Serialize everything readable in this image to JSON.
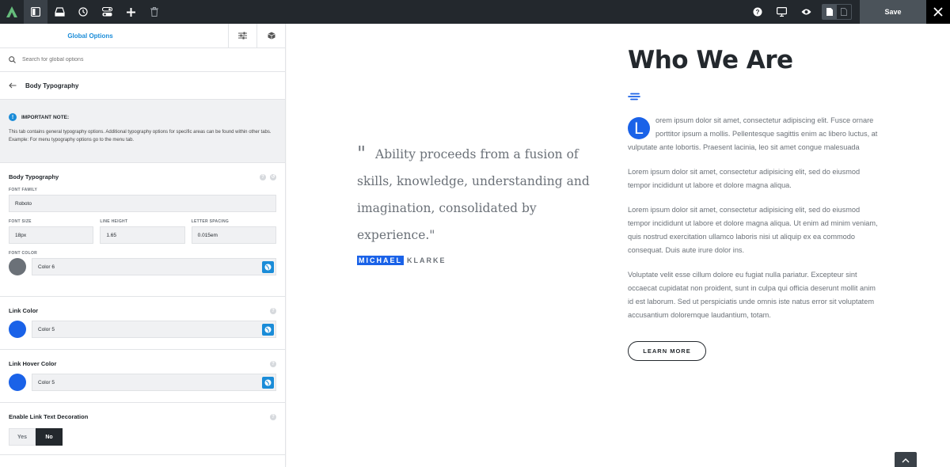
{
  "toolbar": {
    "save_label": "Save",
    "icons": [
      "avada-logo",
      "sidebar-toggle-icon",
      "library-icon",
      "history-icon",
      "toggle-options-icon",
      "add-icon",
      "trash-icon",
      "help-icon",
      "desktop-icon",
      "preview-eye-icon",
      "page-view-icon",
      "page-outline-icon",
      "close-icon"
    ]
  },
  "sidebar": {
    "tab_title": "Global Options",
    "search_placeholder": "Search for global options",
    "back_title": "Body Typography",
    "note": {
      "title": "IMPORTANT NOTE:",
      "text": "This tab contains general typography options. Additional typography options for specific areas can be found within other tabs. Example: For menu typography options go to the menu tab."
    },
    "body_typography": {
      "title": "Body Typography",
      "font_family_label": "FONT FAMILY",
      "font_family_value": "Roboto",
      "font_size_label": "FONT SIZE",
      "font_size_value": "18px",
      "line_height_label": "LINE HEIGHT",
      "line_height_value": "1.65",
      "letter_spacing_label": "LETTER SPACING",
      "letter_spacing_value": "0.015em",
      "font_color_label": "FONT COLOR",
      "font_color_value": "Color 6",
      "font_color_hex": "#6b7178"
    },
    "link_color": {
      "title": "Link Color",
      "value": "Color 5",
      "hex": "#1a62e8"
    },
    "link_hover_color": {
      "title": "Link Hover Color",
      "value": "Color 5",
      "hex": "#1a62e8"
    },
    "link_decoration": {
      "title": "Enable Link Text Decoration",
      "yes": "Yes",
      "no": "No",
      "selected": "No"
    }
  },
  "preview": {
    "quote_mark": "\"",
    "quote": "Ability proceeds from a fusion of skills, knowledge, understanding and imagination, consolidated by experience.\"",
    "author_first": "MICHAEL",
    "author_last": "KLARKE",
    "heading": "Who We Are",
    "dropcap": "L",
    "para1": "orem ipsum dolor sit amet, consectetur adipiscing elit. Fusce ornare porttitor ipsum a mollis. Pellentesque sagittis enim ac libero luctus, at vulputate ante lobortis. Praesent lacinia, leo sit amet congue malesuada",
    "para2": "Lorem ipsum dolor sit amet, consectetur adipisicing elit, sed do eiusmod tempor incididunt ut labore et dolore magna aliqua.",
    "para3": "Lorem ipsum dolor sit amet, consectetur adipisicing elit, sed do eiusmod tempor incididunt ut labore et dolore magna aliqua. Ut enim ad minim veniam, quis nostrud exercitation ullamco laboris nisi ut aliquip ex ea commodo consequat. Duis aute irure dolor ins.",
    "para4": "Voluptate velit esse cillum dolore eu fugiat nulla pariatur. Excepteur sint occaecat cupidatat non proident, sunt in culpa qui officia deserunt mollit anim id est laborum. Sed ut perspiciatis unde omnis iste natus error sit voluptatem accusantium doloremque laudantium, totam.",
    "button_label": "LEARN MORE"
  },
  "colors": {
    "accent": "#1a8cd8",
    "brand_blue": "#1a62e8",
    "toolbar_bg": "#23282d",
    "logo_green": "#65bc7b"
  }
}
